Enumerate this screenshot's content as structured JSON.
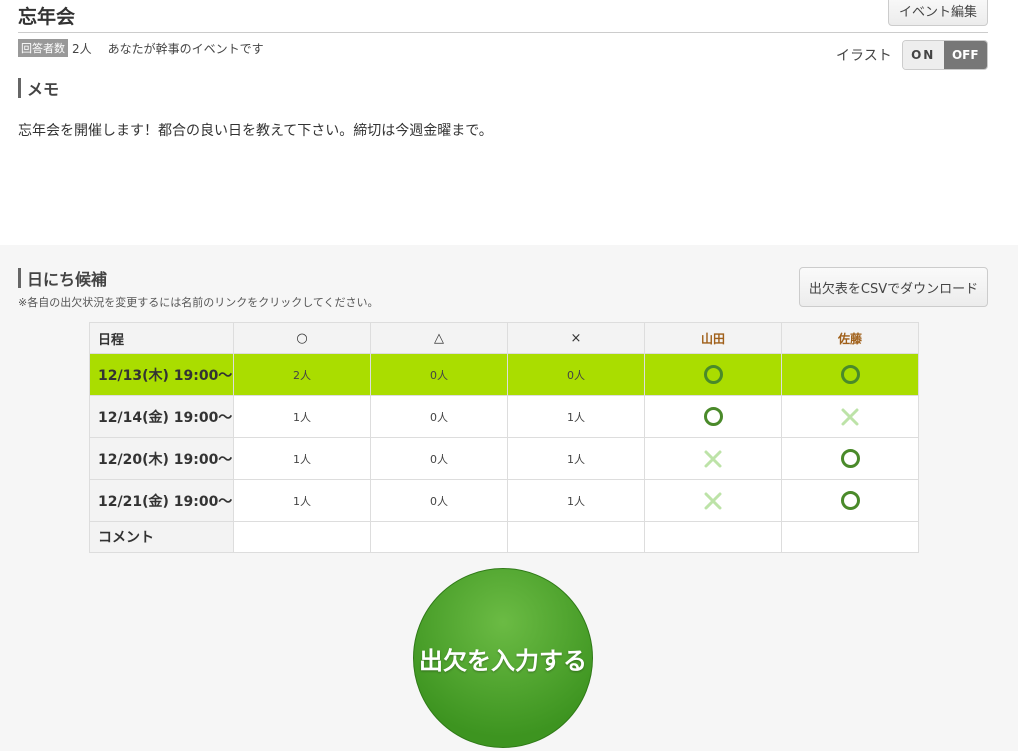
{
  "event": {
    "title": "忘年会",
    "edit_label": "イベント編集",
    "respondents_label": "回答者数",
    "respondents_count": "2人",
    "organizer_note": "あなたが幹事のイベントです"
  },
  "illust": {
    "label": "イラスト",
    "on_label": "ON",
    "off_label": "OFF",
    "selected": "OFF"
  },
  "memo": {
    "heading": "メモ",
    "text": "忘年会を開催します！都合の良い日を教えて下さい。締切は今週金曜まで。"
  },
  "schedule": {
    "heading": "日にち候補",
    "note": "※各自の出欠状況を変更するには名前のリンクをクリックしてください。",
    "csv_label": "出欠表をCSVでダウンロード",
    "columns": [
      "日程",
      "○",
      "△",
      "×",
      "山田",
      "佐藤"
    ],
    "rows": [
      {
        "date": "12/13(木) 19:00～",
        "yes": "2人",
        "maybe": "0人",
        "no": "0人",
        "yamada": "circle",
        "sato": "circle",
        "best": true
      },
      {
        "date": "12/14(金) 19:00～",
        "yes": "1人",
        "maybe": "0人",
        "no": "1人",
        "yamada": "circle",
        "sato": "cross",
        "best": false
      },
      {
        "date": "12/20(木) 19:00～",
        "yes": "1人",
        "maybe": "0人",
        "no": "1人",
        "yamada": "cross",
        "sato": "circle",
        "best": false
      },
      {
        "date": "12/21(金) 19:00～",
        "yes": "1人",
        "maybe": "0人",
        "no": "1人",
        "yamada": "cross",
        "sato": "circle",
        "best": false
      }
    ],
    "comment_label": "コメント",
    "highlight_color": "#aadd00"
  },
  "submit": {
    "label": "出欠を入力する"
  }
}
